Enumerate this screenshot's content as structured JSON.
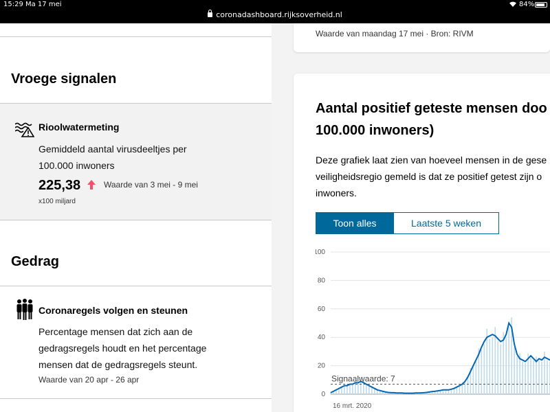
{
  "statusbar": {
    "time": "15:29",
    "date": "Ma 17 mei",
    "url": "coronadashboard.rijksoverheid.nl",
    "battery": "84%",
    "battery_level": 0.84
  },
  "sidebar": {
    "early_signals": {
      "heading": "Vroege signalen",
      "metric": {
        "icon": "sewer-water-icon",
        "title": "Rioolwatermeting",
        "description_line1": "Gemiddeld aantal virusdeeltjes per",
        "description_line2": "100.000 inwoners",
        "value": "225,38",
        "trend": "up",
        "period": "Waarde van 3 mei - 9 mei",
        "unit": "x100 miljard"
      }
    },
    "behaviour": {
      "heading": "Gedrag",
      "metric": {
        "icon": "group-people-icon",
        "title": "Coronaregels volgen en steunen",
        "description_line1": "Percentage mensen dat zich aan de",
        "description_line2": "gedragsregels houdt en het percentage",
        "description_line3": "mensen dat de gedragsregels steunt.",
        "period": "Waarde van 20 apr - 26 apr"
      }
    }
  },
  "top_card": {
    "meta": "Waarde van maandag 17 mei · Bron: RIVM"
  },
  "card": {
    "title_line1": "Aantal positief geteste mensen doo",
    "title_line2": "100.000 inwoners)",
    "desc_line1": "Deze grafiek laat zien van hoeveel mensen in de gese",
    "desc_line2": "veiligheidsregio gemeld is dat ze positief getest zijn o",
    "desc_line3": "inwoners.",
    "tabs": [
      "Toon alles",
      "Laatste 5 weken"
    ],
    "active_tab": 0
  },
  "colors": {
    "accent": "#01689b",
    "line": "#0566b1",
    "bars": "#bcd9ee",
    "trend_up": "#f35065"
  },
  "chart_data": {
    "type": "line",
    "ylim": [
      0,
      100
    ],
    "yticks": [
      0,
      20,
      40,
      60,
      80,
      100
    ],
    "x_tick_label": "16 mrt. 2020",
    "threshold": {
      "label": "Signaalwaarde: 7",
      "value": 7
    },
    "series": [
      {
        "x": [
          0,
          4,
          8,
          12,
          16,
          20,
          24,
          28,
          32,
          36,
          40,
          44,
          48,
          52,
          56,
          60,
          64,
          68,
          72,
          76,
          80,
          84,
          88,
          92,
          96,
          100,
          104,
          108,
          112,
          116,
          120,
          124,
          128,
          132,
          136,
          140,
          144,
          148,
          152,
          156,
          160,
          164,
          168,
          172,
          176,
          180,
          184,
          188,
          192,
          196,
          200,
          204,
          208,
          212,
          216,
          220,
          224,
          228,
          232,
          236,
          240,
          244,
          248,
          252,
          256,
          260,
          264,
          268,
          272,
          276,
          280,
          284,
          288,
          292,
          296,
          300,
          304,
          308,
          312,
          316,
          320
        ],
        "y": [
          1,
          2,
          3,
          4,
          5,
          6,
          6,
          7,
          7,
          8,
          8,
          9,
          8,
          7,
          6,
          5,
          4,
          3,
          2.5,
          2,
          1.5,
          1.2,
          1,
          1,
          0.8,
          0.8,
          0.8,
          0.7,
          0.7,
          0.7,
          0.7,
          0.8,
          0.8,
          0.9,
          1,
          1.2,
          1.5,
          1.8,
          2,
          2.3,
          2.6,
          3,
          3,
          3,
          3.5,
          4,
          5,
          6,
          7,
          9,
          12,
          16,
          20,
          24,
          28,
          33,
          37,
          40,
          41,
          42,
          41,
          39,
          37,
          38,
          42,
          50,
          47,
          35,
          28,
          25,
          24,
          23,
          25,
          27,
          25,
          23,
          25,
          24,
          26,
          25,
          24
        ]
      }
    ]
  }
}
